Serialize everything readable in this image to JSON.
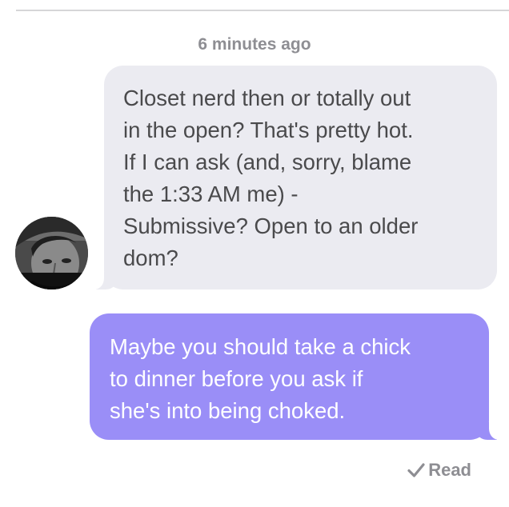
{
  "conversation": {
    "timestamp": "6 minutes ago",
    "incoming": {
      "lines": [
        "Closet nerd then or totally out",
        "in the open? That's pretty hot.",
        "If I can ask (and, sorry, blame",
        "the 1:33 AM me) -",
        "Submissive? Open to an older",
        "dom?"
      ],
      "avatar_icon": "user-avatar-photo"
    },
    "outgoing": {
      "lines": [
        "Maybe you should take a chick",
        "to dinner before you ask if",
        "she's into being choked."
      ]
    },
    "receipt": {
      "icon": "checkmark-icon",
      "label": "Read"
    }
  },
  "colors": {
    "incoming_bubble": "#ebebf1",
    "outgoing_bubble": "#9a8ef7",
    "meta_text": "#8e8e93"
  }
}
